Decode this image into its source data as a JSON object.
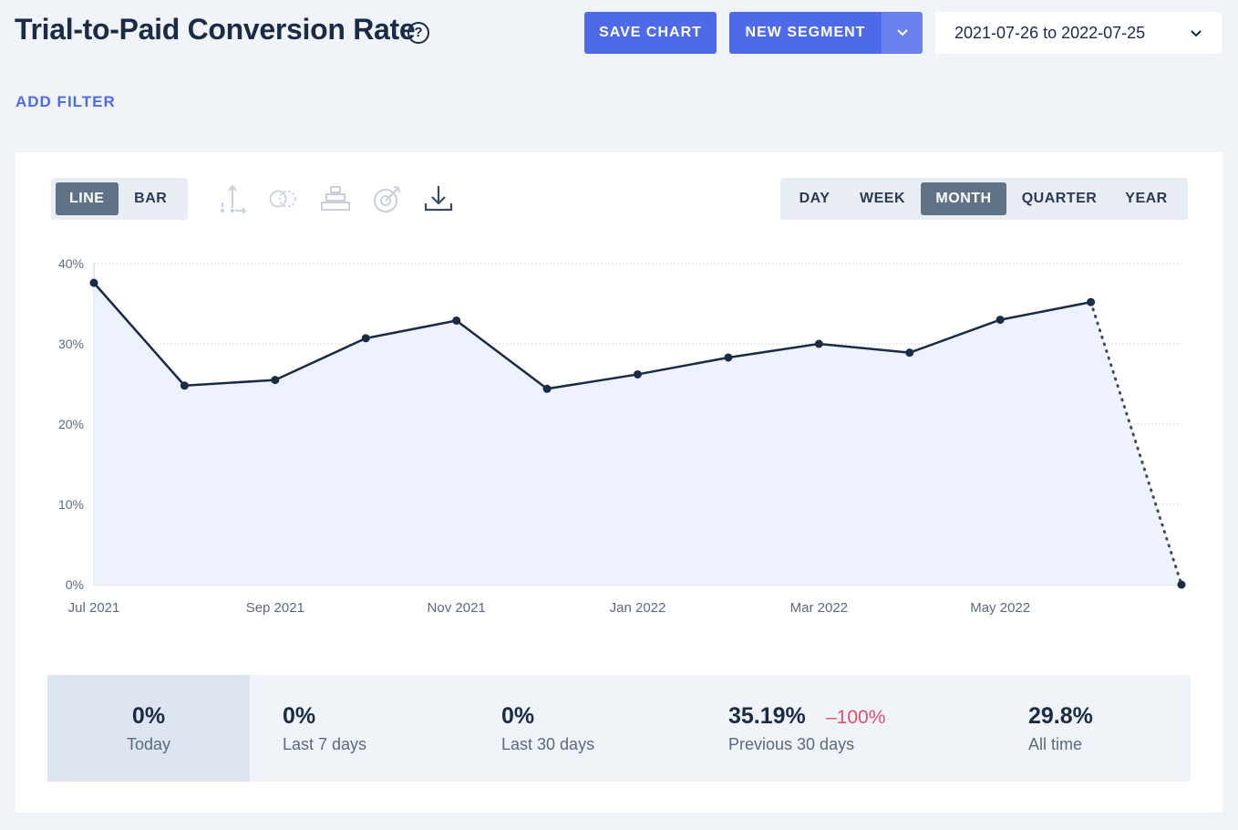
{
  "header": {
    "title": "Trial-to-Paid Conversion Rate",
    "help_icon": "?",
    "save_label": "SAVE CHART",
    "segment_label": "NEW SEGMENT",
    "date_range": "2021-07-26 to 2022-07-25"
  },
  "filters": {
    "add_label": "ADD FILTER"
  },
  "toolbar": {
    "chart_types": [
      {
        "label": "LINE",
        "active": true
      },
      {
        "label": "BAR",
        "active": false
      }
    ],
    "tool_icons": [
      "axis-icon",
      "compare-icon",
      "stack-icon",
      "goal-icon",
      "download-icon"
    ],
    "periods": [
      {
        "label": "DAY",
        "active": false
      },
      {
        "label": "WEEK",
        "active": false
      },
      {
        "label": "MONTH",
        "active": true
      },
      {
        "label": "QUARTER",
        "active": false
      },
      {
        "label": "YEAR",
        "active": false
      }
    ]
  },
  "chart_data": {
    "type": "line",
    "x": [
      "2021-07",
      "2021-08",
      "2021-09",
      "2021-10",
      "2021-11",
      "2021-12",
      "2022-01",
      "2022-02",
      "2022-03",
      "2022-04",
      "2022-05",
      "2022-06",
      "2022-07"
    ],
    "values": [
      37.6,
      24.8,
      25.5,
      30.7,
      32.9,
      24.4,
      26.2,
      28.3,
      30.0,
      28.9,
      33.0,
      35.2,
      0
    ],
    "incomplete_last_point": true,
    "xticks": [
      "Jul 2021",
      "Sep 2021",
      "Nov 2021",
      "Jan 2022",
      "Mar 2022",
      "May 2022"
    ],
    "yticks": [
      "0%",
      "10%",
      "20%",
      "30%",
      "40%"
    ],
    "ylim": [
      0,
      40
    ],
    "grid": true,
    "colors": {
      "line": "#1b2b45",
      "fill": "#eef2fc",
      "grid": "#d4dae3"
    }
  },
  "stats": [
    {
      "value": "0%",
      "label": "Today"
    },
    {
      "value": "0%",
      "label": "Last 7 days"
    },
    {
      "value": "0%",
      "label": "Last 30 days"
    },
    {
      "value": "35.19%",
      "label": "Previous 30 days",
      "change": "–100%"
    },
    {
      "value": "29.8%",
      "label": "All time"
    }
  ],
  "colors": {
    "accent": "#4f6ae8",
    "negative": "#e0506a"
  }
}
